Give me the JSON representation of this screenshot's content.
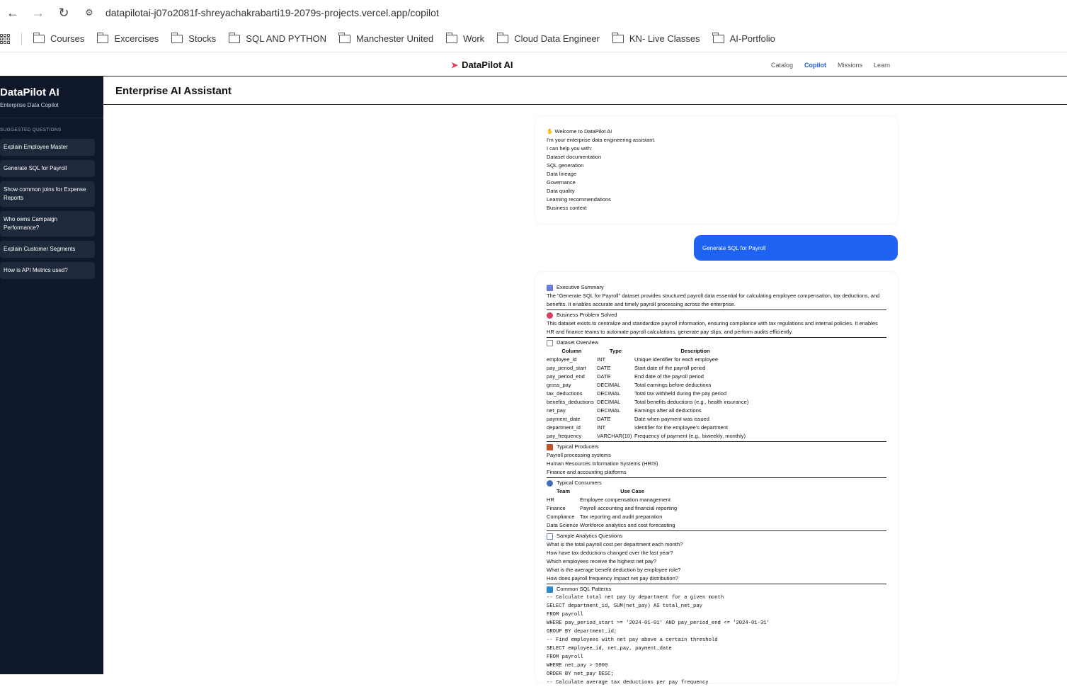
{
  "browser": {
    "url": "datapilotai-j07o2081f-shreyachakrabarti19-2079s-projects.vercel.app/copilot",
    "bookmarks": [
      "Courses",
      "Excercises",
      "Stocks",
      "SQL AND PYTHON",
      "Manchester United",
      "Work",
      "Cloud Data Engineer",
      "KN- Live Classes",
      "AI-Portfolio"
    ]
  },
  "topbar": {
    "brand": "DataPilot AI",
    "links": [
      "Catalog",
      "Copilot",
      "Missions",
      "Learn"
    ],
    "active_link": "Copilot"
  },
  "sidebar": {
    "title": "DataPilot AI",
    "subtitle": "Enterprise Data Copilot",
    "section_label": "SUGGESTED QUESTIONS",
    "items": [
      "Explain Employee Master",
      "Generate SQL for Payroll",
      "Show common joins for Expense Reports",
      "Who owns Campaign Performance?",
      "Explain Customer Segments",
      "How is API Metrics used?"
    ]
  },
  "main": {
    "title": "Enterprise AI Assistant"
  },
  "welcome": {
    "heading": "Welcome to DataPilot AI",
    "intro": "I'm your enterprise data engineering assistant.",
    "help": "I can help you with:",
    "items": [
      "Dataset documentation",
      "SQL generation",
      "Data lineage",
      "Governance",
      "Data quality",
      "Learning recommendations",
      "Business context"
    ]
  },
  "user_message": "Generate SQL for Payroll",
  "answer": {
    "exec_summary": {
      "heading": "Executive Summary",
      "text": "The \"Generate SQL for Payroll\" dataset provides structured payroll data essential for calculating employee compensation, tax deductions, and benefits. It enables accurate and timely payroll processing across the enterprise."
    },
    "business_problem": {
      "heading": "Business Problem Solved",
      "text": "This dataset exists to centralize and standardize payroll information, ensuring compliance with tax regulations and internal policies. It enables HR and finance teams to automate payroll calculations, generate pay slips, and perform audits efficiently."
    },
    "dataset_overview": {
      "heading": "Dataset Overview",
      "columns": [
        "Column",
        "Type",
        "Description"
      ],
      "rows": [
        [
          "employee_id",
          "INT",
          "Unique identifier for each employee"
        ],
        [
          "pay_period_start",
          "DATE",
          "Start date of the payroll period"
        ],
        [
          "pay_period_end",
          "DATE",
          "End date of the payroll period"
        ],
        [
          "gross_pay",
          "DECIMAL",
          "Total earnings before deductions"
        ],
        [
          "tax_deductions",
          "DECIMAL",
          "Total tax withheld during the pay period"
        ],
        [
          "benefits_deductions",
          "DECIMAL",
          "Total benefits deductions (e.g., health insurance)"
        ],
        [
          "net_pay",
          "DECIMAL",
          "Earnings after all deductions"
        ],
        [
          "payment_date",
          "DATE",
          "Date when payment was issued"
        ],
        [
          "department_id",
          "INT",
          "Identifier for the employee's department"
        ],
        [
          "pay_frequency",
          "VARCHAR(10)",
          "Frequency of payment (e.g., biweekly, monthly)"
        ]
      ]
    },
    "producers": {
      "heading": "Typical Producers",
      "items": [
        "Payroll processing systems",
        "Human Resources Information Systems (HRIS)",
        "Finance and accounting platforms"
      ]
    },
    "consumers": {
      "heading": "Typical Consumers",
      "columns": [
        "Team",
        "Use Case"
      ],
      "rows": [
        [
          "HR",
          "Employee compensation management"
        ],
        [
          "Finance",
          "Payroll accounting and financial reporting"
        ],
        [
          "Compliance",
          "Tax reporting and audit preparation"
        ],
        [
          "Data Science",
          "Workforce analytics and cost forecasting"
        ]
      ]
    },
    "questions": {
      "heading": "Sample Analytics Questions",
      "items": [
        "What is the total payroll cost per department each month?",
        "How have tax deductions changed over the last year?",
        "Which employees receive the highest net pay?",
        "What is the average benefit deduction by employee role?",
        "How does payroll frequency impact net pay distribution?"
      ]
    },
    "sql": {
      "heading": "Common SQL Patterns",
      "lines": [
        "-- Calculate total net pay by department for a given month",
        "SELECT department_id, SUM(net_pay) AS total_net_pay",
        "FROM payroll",
        "WHERE pay_period_start >= '2024-01-01' AND pay_period_end <= '2024-01-31'",
        "GROUP BY department_id;",
        "-- Find employees with net pay above a certain threshold",
        "SELECT employee_id, net_pay, payment_date",
        "FROM payroll",
        "WHERE net_pay > 5000",
        "ORDER BY net_pay DESC;",
        "-- Calculate average tax deductions per pay frequency"
      ]
    }
  },
  "colors": {
    "sidebar_bg": "#0f172a",
    "sidebar_item_bg": "#1e293b",
    "accent": "#1f63f5",
    "active_link": "#1d5bd8"
  }
}
